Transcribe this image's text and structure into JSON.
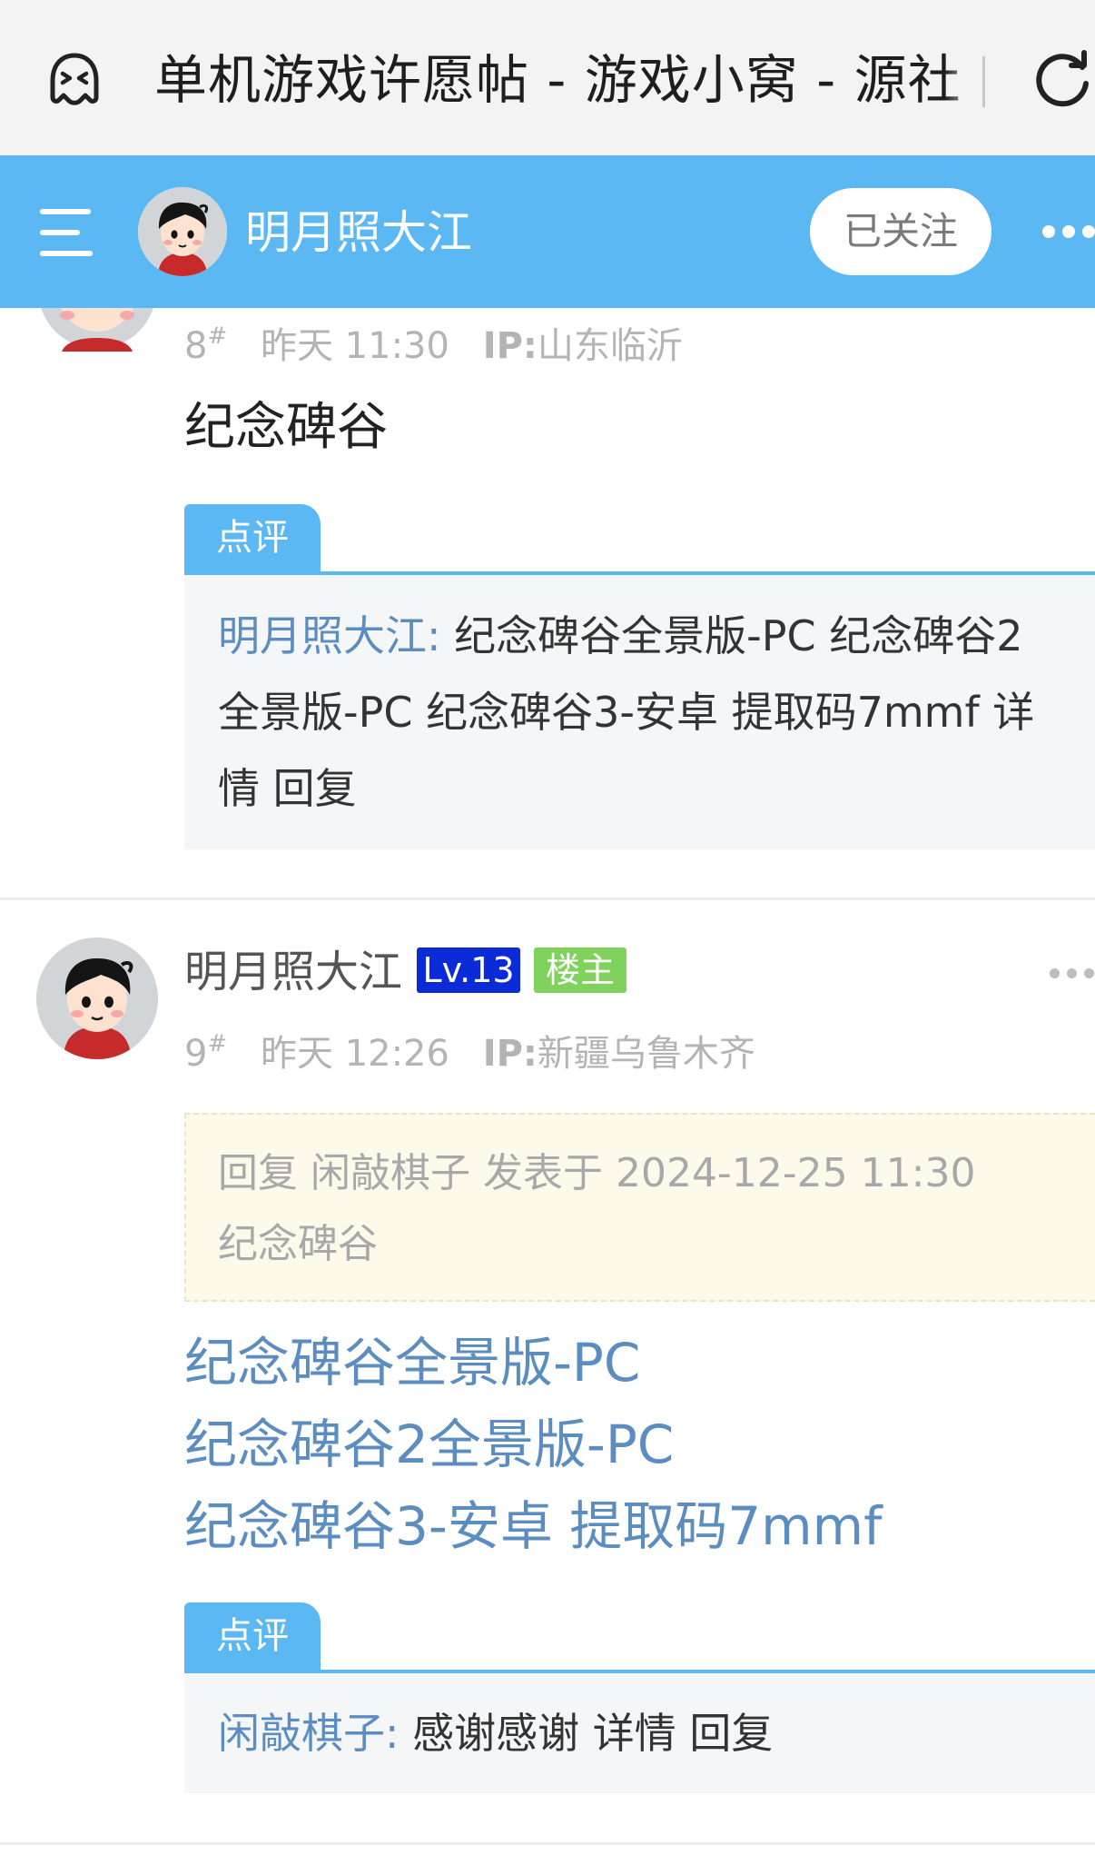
{
  "browser": {
    "page_title": "单机游戏许愿帖 - 游戏小窝 - 源社",
    "ghost_icon": "ghost-face-icon",
    "reload_icon": "reload-icon"
  },
  "header": {
    "menu_icon": "menu-icon",
    "avatar": "user-avatar",
    "username": "明月照大江",
    "follow_label": "已关注",
    "more_icon": "more-icon"
  },
  "posts": [
    {
      "floor": "8",
      "floor_mark": "#",
      "time": "昨天 11:30",
      "ip_label": "IP:",
      "ip_location": "山东临沂",
      "content": "纪念碑谷",
      "review_tag": "点评",
      "review": {
        "author": "明月照大江:",
        "line1": "纪念碑谷全景版-PC 纪念碑谷2",
        "line2": "全景版-PC 纪念碑谷3-安卓 提取码7mmf  详",
        "line3": "情 回复"
      }
    },
    {
      "floor": "9",
      "floor_mark": "#",
      "author": "明月照大江",
      "level": "Lv.13",
      "op_badge": "楼主",
      "time": "昨天 12:26",
      "ip_label": "IP:",
      "ip_location": "新疆乌鲁木齐",
      "quote": {
        "line1": "回复 闲敲棋子 发表于 2024-12-25 11:30",
        "line2": "纪念碑谷"
      },
      "links": [
        "纪念碑谷全景版-PC",
        "纪念碑谷2全景版-PC",
        "纪念碑谷3-安卓 提取码7mmf"
      ],
      "review_tag": "点评",
      "review": {
        "author": "闲敲棋子:",
        "text": "感谢感谢  详情 回复"
      }
    }
  ],
  "colors": {
    "header_blue": "#5cb8f2",
    "link_blue": "#5c8dc0",
    "level_badge": "#0b2bd8",
    "op_badge": "#7fd25c"
  }
}
